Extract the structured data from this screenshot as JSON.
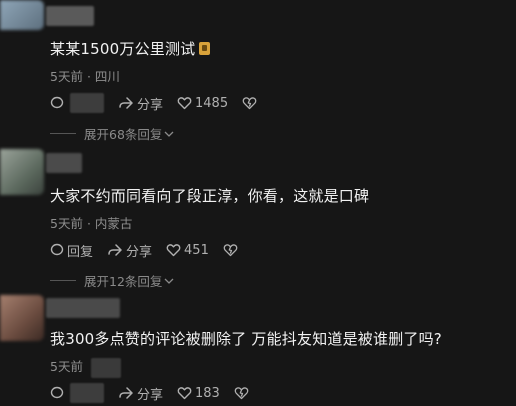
{
  "comments": [
    {
      "text": "某某1500万公里测试",
      "time": "5天前",
      "location": "四川",
      "reply_label": "",
      "share_label": "分享",
      "likes": "1485",
      "expand_label": "展开68条回复"
    },
    {
      "text": "大家不约而同看向了段正淳，你看，这就是口碑",
      "time": "5天前",
      "location": "内蒙古",
      "reply_label": "回复",
      "share_label": "分享",
      "likes": "451",
      "expand_label": "展开12条回复"
    },
    {
      "text": "我300多点赞的评论被删除了 万能抖友知道是被谁删了吗?",
      "time": "5天前",
      "location": "",
      "reply_label": "",
      "share_label": "分享",
      "likes": "183"
    }
  ],
  "separator": "·",
  "icons": [
    "comment-icon",
    "share-icon",
    "heart-icon",
    "dislike-icon",
    "chevron-down-icon",
    "badge-icon"
  ]
}
